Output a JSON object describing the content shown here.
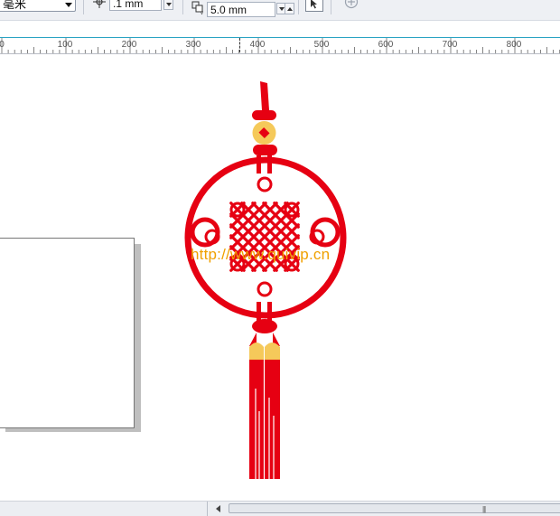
{
  "toolbar": {
    "units_value": "毫米",
    "nudge_icon": "nudge-distance-icon",
    "nudge_value": ".1 mm",
    "duplicate_icon": "duplicate-distance-icon",
    "duplicate_value": "5.0 mm",
    "select_tool_icon": "pick-tool-icon",
    "add_icon": "add-circle-icon"
  },
  "ruler": {
    "labels": [
      "0",
      "100",
      "200",
      "300",
      "400",
      "500",
      "600",
      "700",
      "800"
    ]
  },
  "canvas": {
    "watermark": "http://www.quivip.cn",
    "accent_color": "#e60012",
    "gold_color": "#f5c95a"
  },
  "scrollbar": {
    "grip": "|||"
  }
}
